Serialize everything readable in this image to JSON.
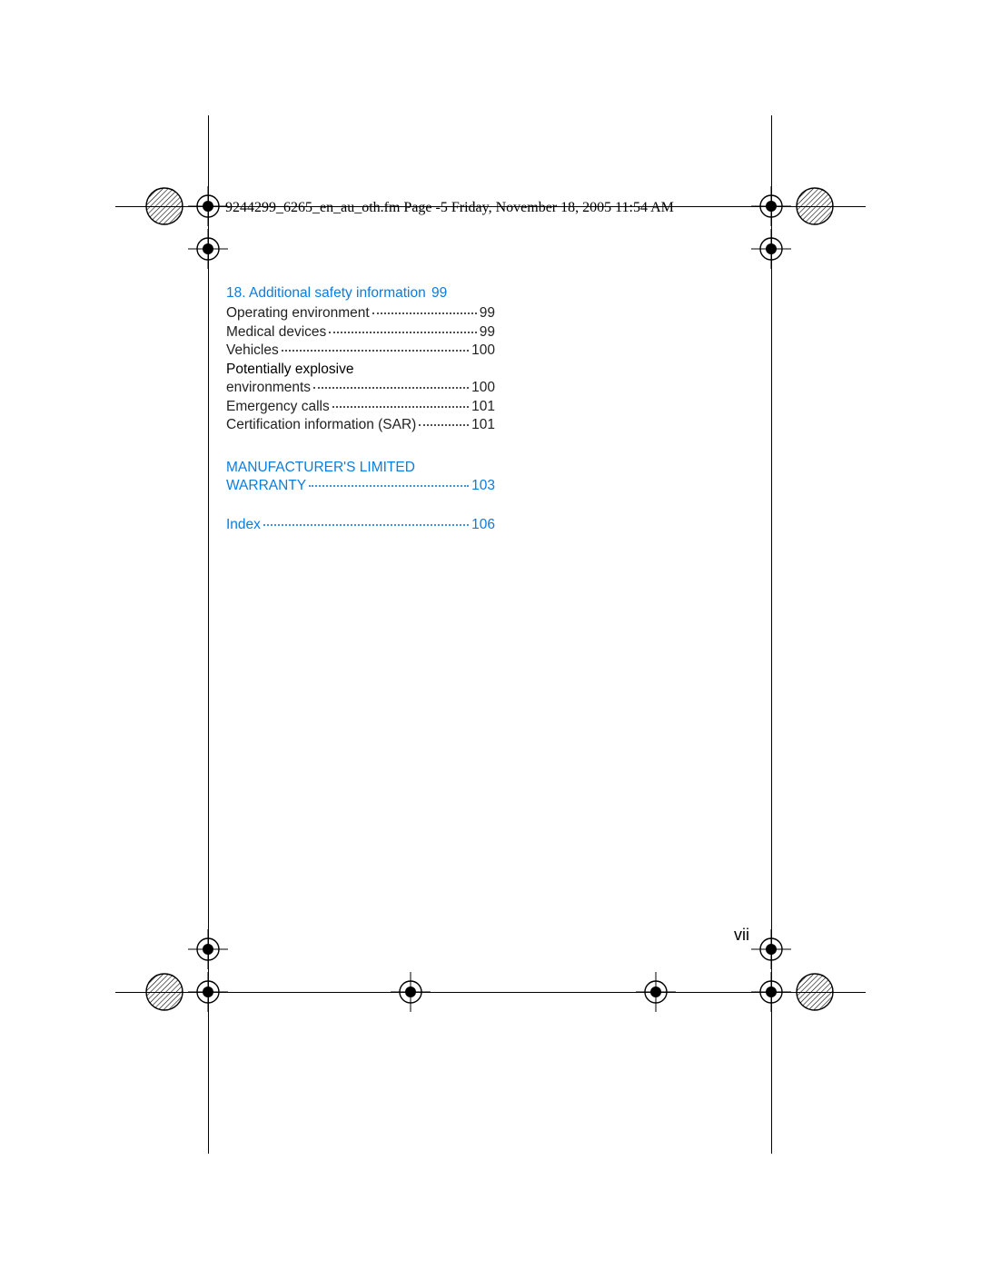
{
  "header_text": "9244299_6265_en_au_oth.fm  Page -5  Friday, November 18, 2005  11:54 AM",
  "page_number": "vii",
  "section_heading": {
    "num": "18.",
    "title": "Additional safety information",
    "page": "99"
  },
  "entries": [
    {
      "label": "Operating environment",
      "page": "99"
    },
    {
      "label": "Medical devices",
      "page": "99"
    },
    {
      "label": "Vehicles",
      "page": "100"
    }
  ],
  "wrap_entry": {
    "line1": "Potentially explosive",
    "line2": "environments",
    "page": "100"
  },
  "entries2": [
    {
      "label": "Emergency calls",
      "page": "101"
    },
    {
      "label": "Certification information (SAR)",
      "page": "101"
    }
  ],
  "warranty": {
    "line1": "MANUFACTURER'S LIMITED",
    "line2": "WARRANTY",
    "page": "103"
  },
  "index": {
    "label": "Index",
    "page": "106"
  }
}
